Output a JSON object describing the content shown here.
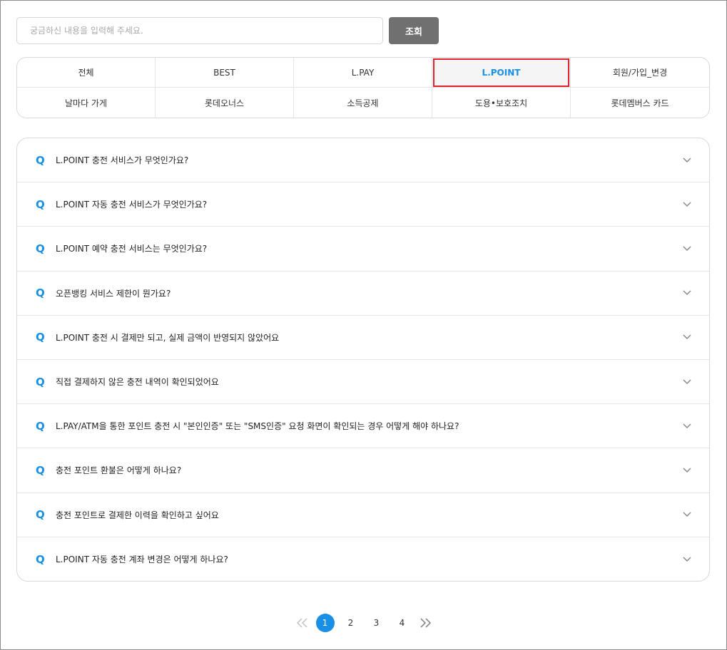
{
  "search": {
    "placeholder": "궁금하신 내용을 입력해 주세요.",
    "value": "",
    "button_label": "조회"
  },
  "categories": [
    {
      "label": "전체"
    },
    {
      "label": "BEST"
    },
    {
      "label": "L.PAY"
    },
    {
      "label": "L.POINT",
      "active": true
    },
    {
      "label": "회원/가입_변경"
    },
    {
      "label": "날마다 가게"
    },
    {
      "label": "롯데오너스"
    },
    {
      "label": "소득공제"
    },
    {
      "label": "도용•보호조치"
    },
    {
      "label": "롯데멤버스 카드"
    }
  ],
  "faq": {
    "q_mark": "Q",
    "items": [
      {
        "question": "L.POINT 충전 서비스가 무엇인가요?"
      },
      {
        "question": "L.POINT 자동 충전 서비스가 무엇인가요?"
      },
      {
        "question": "L.POINT 예약 충전 서비스는 무엇인가요?"
      },
      {
        "question": "오픈뱅킹 서비스 제한이 뭔가요?"
      },
      {
        "question": "L.POINT 충전 시 결제만 되고, 실제 금액이 반영되지 않았어요"
      },
      {
        "question": "직접 결제하지 않은 충전 내역이 확인되었어요"
      },
      {
        "question": "L.PAY/ATM을 통한 포인트 충전 시 \"본인인증\" 또는 \"SMS인증\" 요청 화면이 확인되는 경우 어떻게 해야 하나요?"
      },
      {
        "question": "충전 포인트 환불은 어떻게 하나요?"
      },
      {
        "question": "충전 포인트로 결제한 이력을 확인하고 싶어요"
      },
      {
        "question": "L.POINT 자동 충전 계좌 변경은 어떻게 하나요?"
      }
    ]
  },
  "pagination": {
    "pages": [
      "1",
      "2",
      "3",
      "4"
    ],
    "current": "1"
  },
  "colors": {
    "accent": "#1a8fe6",
    "active_outline": "#e0242b",
    "search_button": "#707070"
  },
  "icons": {
    "expand": "chevron-down-icon",
    "first_page": "double-chevron-left-icon",
    "last_page": "double-chevron-right-icon"
  }
}
